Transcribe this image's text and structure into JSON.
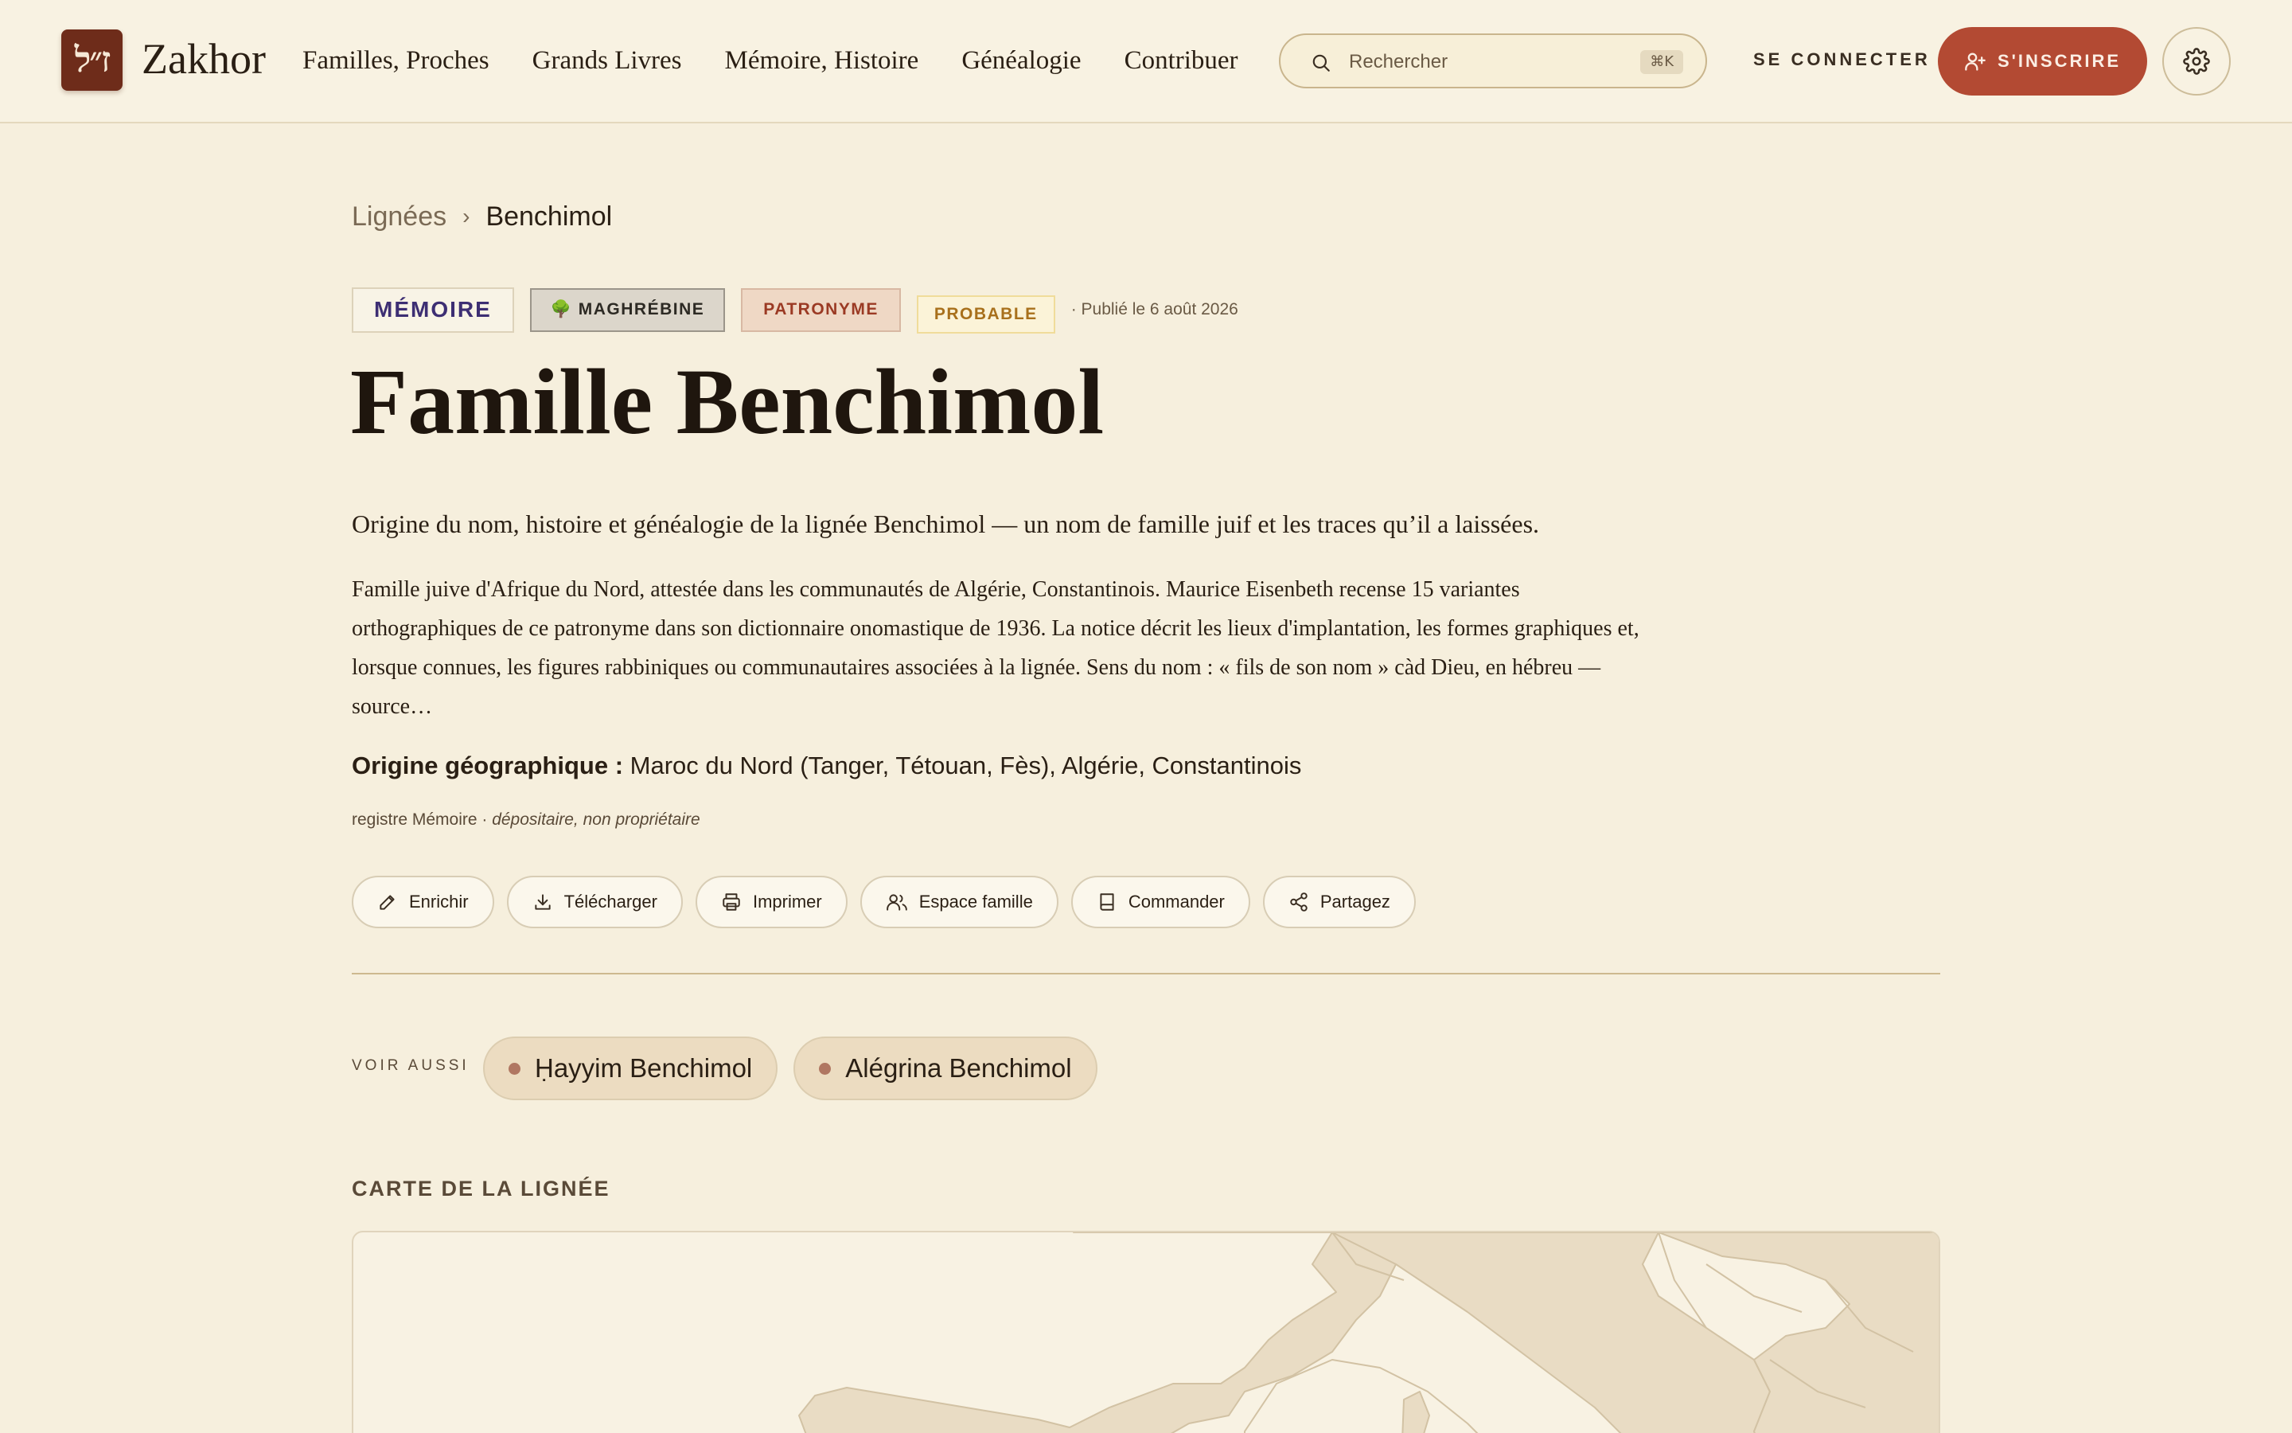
{
  "header": {
    "logo_glyph": "ז״ל",
    "brand": "Zakhor",
    "nav": [
      {
        "label": "Familles, Proches"
      },
      {
        "label": "Grands Livres"
      },
      {
        "label": "Mémoire, Histoire"
      },
      {
        "label": "Généalogie"
      },
      {
        "label": "Contribuer"
      }
    ],
    "search": {
      "placeholder": "Rechercher",
      "shortcut": "⌘K"
    },
    "login_label": "SE CONNECTER",
    "signup_label": "S'INSCRIRE"
  },
  "breadcrumb": {
    "parent": "Lignées",
    "separator": "›",
    "current": "Benchimol"
  },
  "badges": {
    "memoire": "MÉMOIRE",
    "maghrebine": "🌳 MAGHRÉBINE",
    "patronyme": "PATRONYME",
    "probable": "PROBABLE",
    "published": "· Publié le 6 août 2026"
  },
  "title": "Famille Benchimol",
  "lead": "Origine du nom, histoire et généalogie de la lignée Benchimol — un nom de famille juif et les traces qu’il a laissées.",
  "body": "Famille juive d'Afrique du Nord, attestée dans les communautés de Algérie, Constantinois. Maurice Eisenbeth recense 15 variantes orthographiques de ce patronyme dans son dictionnaire onomastique de 1936. La notice décrit les lieux d'implantation, les formes graphiques et, lorsque connues, les figures rabbiniques ou communautaires associées à la lignée. Sens du nom : « fils de son nom » càd Dieu, en hébreu — source…",
  "origin": {
    "label": "Origine géographique :",
    "value": " Maroc du Nord (Tanger, Tétouan, Fès), Algérie, Constantinois"
  },
  "registry": {
    "prefix": "registre Mémoire · ",
    "note": "dépositaire, non propriétaire"
  },
  "actions": [
    {
      "label": "Enrichir",
      "icon": "pencil-icon"
    },
    {
      "label": "Télécharger",
      "icon": "download-icon"
    },
    {
      "label": "Imprimer",
      "icon": "printer-icon"
    },
    {
      "label": "Espace famille",
      "icon": "users-icon"
    },
    {
      "label": "Commander",
      "icon": "book-icon"
    },
    {
      "label": "Partagez",
      "icon": "share-icon"
    }
  ],
  "see_also": {
    "label": "VOIR AUSSI",
    "items": [
      {
        "label": "Ḥayyim Benchimol"
      },
      {
        "label": "Alégrina Benchimol"
      }
    ]
  },
  "map": {
    "title": "CARTE DE LA LIGNÉE"
  },
  "colors": {
    "accent": "#b34a33",
    "logo": "#6e2c1a",
    "background": "#f6efdd",
    "map_land": "#e9dcc4"
  }
}
